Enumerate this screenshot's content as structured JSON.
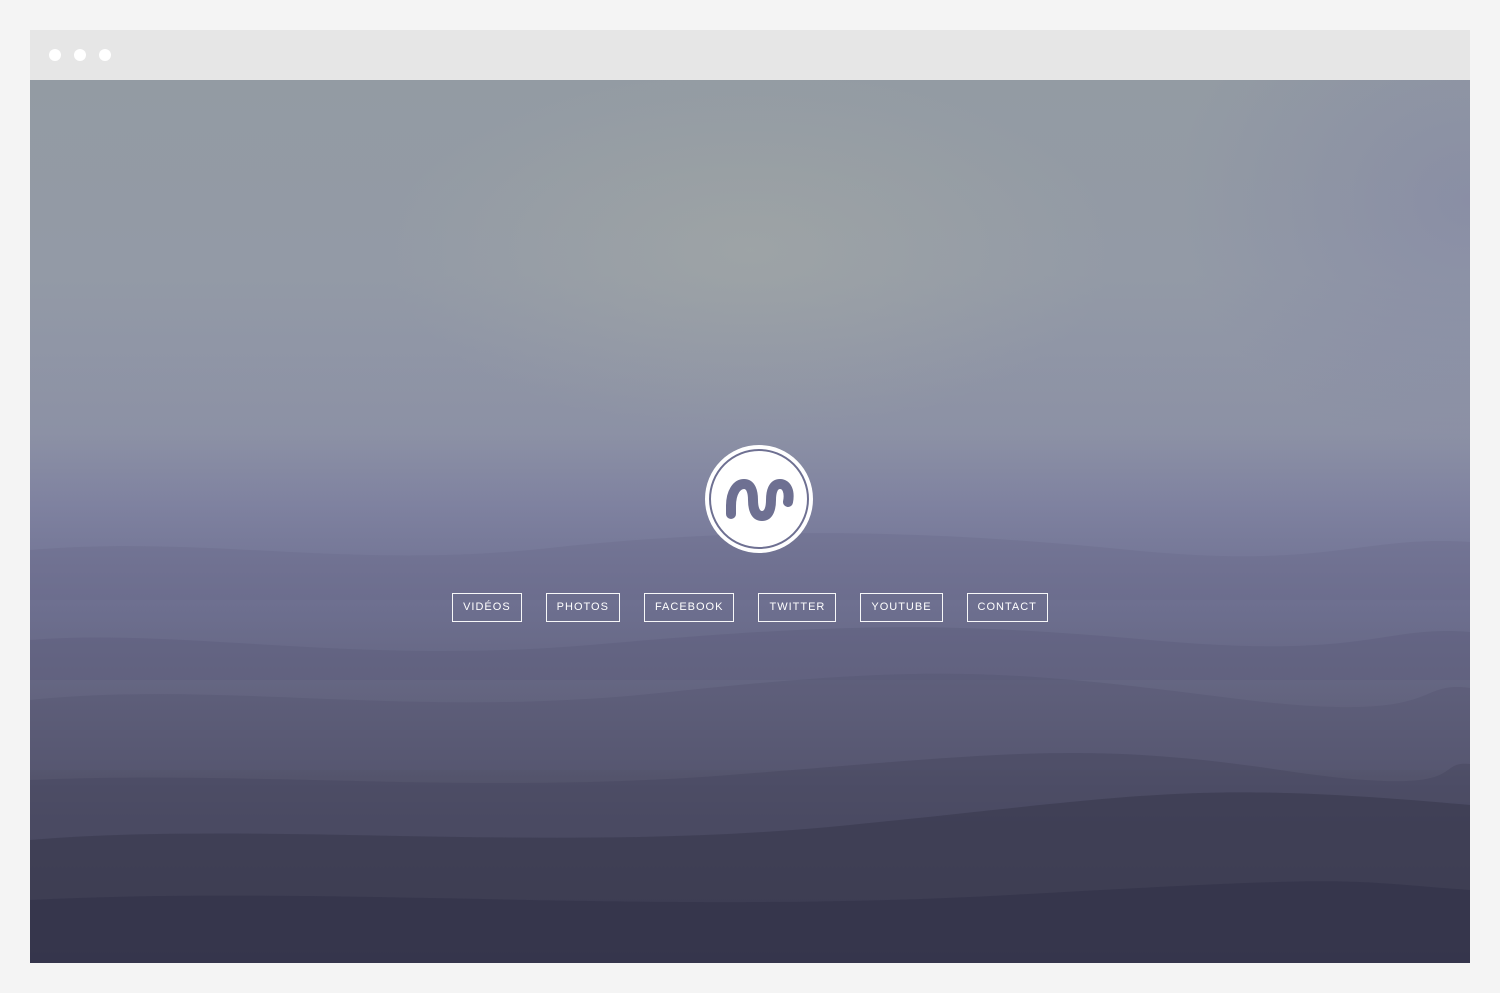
{
  "nav": {
    "items": [
      {
        "label": "VIDÉOS"
      },
      {
        "label": "PHOTOS"
      },
      {
        "label": "FACEBOOK"
      },
      {
        "label": "TWITTER"
      },
      {
        "label": "YOUTUBE"
      },
      {
        "label": "CONTACT"
      }
    ]
  },
  "logo": {
    "icon": "wm-monogram-icon"
  },
  "colors": {
    "page_background": "#f4f4f4",
    "titlebar": "#e6e6e6",
    "logo_fill": "#ffffff",
    "logo_mark": "#6e7092",
    "nav_text": "#ffffff"
  }
}
